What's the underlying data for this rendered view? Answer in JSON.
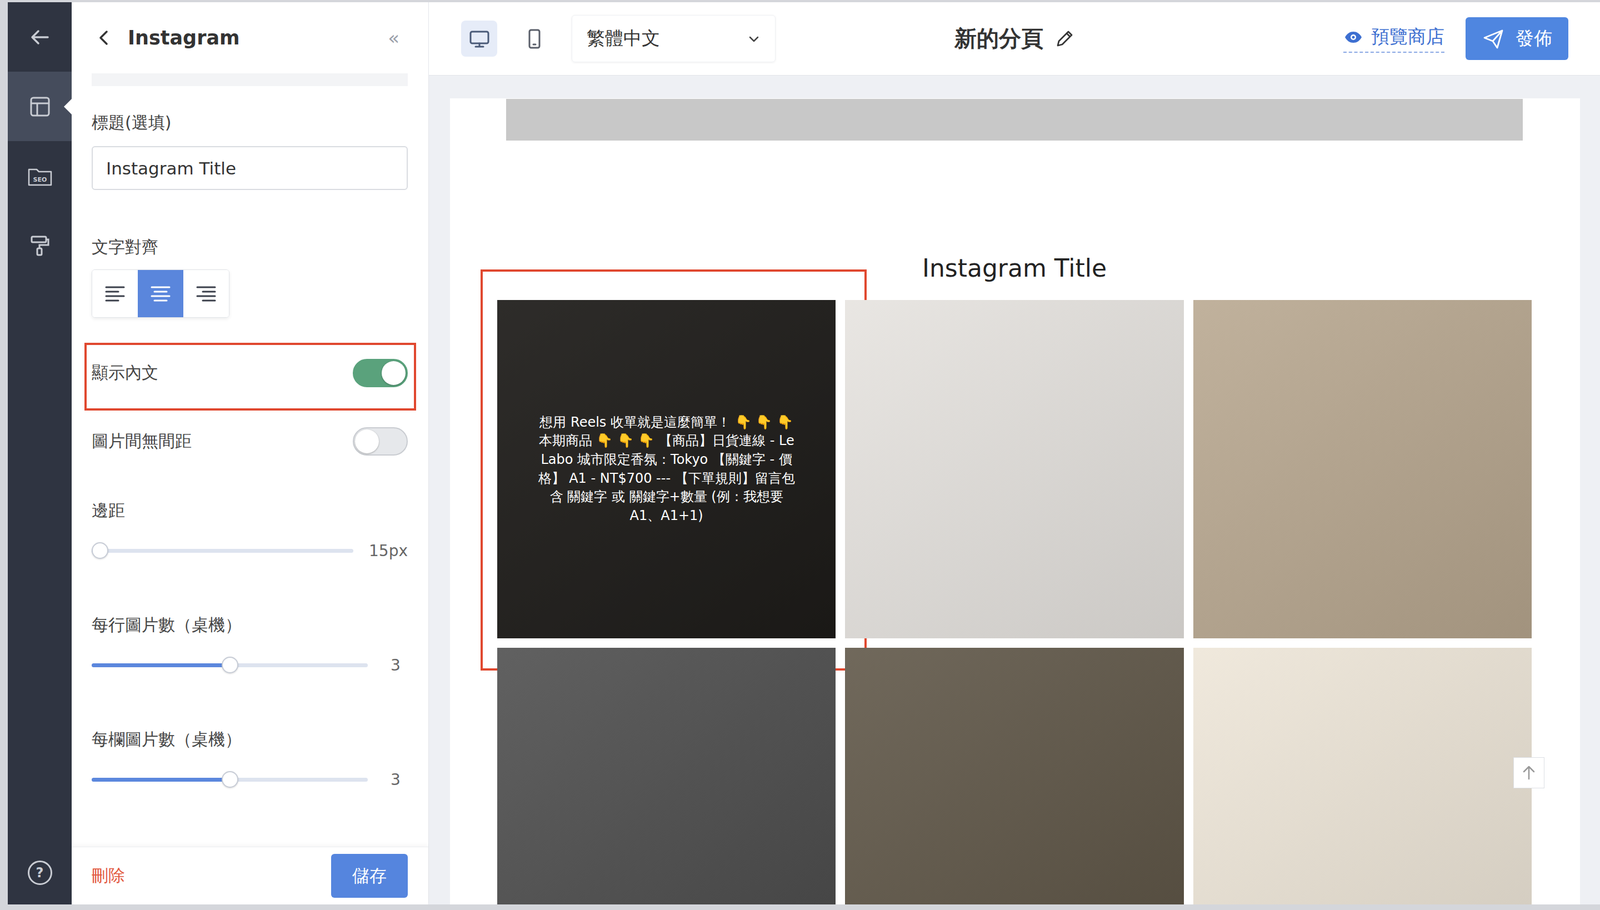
{
  "rail": {
    "items": [
      {
        "kind": "layout",
        "selected": true
      },
      {
        "kind": "seo",
        "label": "SEO",
        "selected": false
      },
      {
        "kind": "style",
        "selected": false
      }
    ],
    "help": "?"
  },
  "panel": {
    "title": "Instagram",
    "collapse": "«",
    "title_field": {
      "label": "標題(選填)",
      "value": "Instagram Title"
    },
    "alignment": {
      "label": "文字對齊",
      "options": [
        {
          "kind": "left",
          "selected": false
        },
        {
          "kind": "center",
          "selected": true
        },
        {
          "kind": "right",
          "selected": false
        }
      ]
    },
    "toggles": [
      {
        "label": "顯示內文",
        "on": true,
        "highlighted": true
      },
      {
        "label": "圖片間無間距",
        "on": false,
        "highlighted": false
      }
    ],
    "sliders": [
      {
        "label": "邊距",
        "level": 0.0,
        "reading": "15px"
      },
      {
        "label": "每行圖片數（桌機）",
        "level": 0.5,
        "reading": "3"
      },
      {
        "label": "每欄圖片數（桌機）",
        "level": 0.5,
        "reading": "3"
      }
    ],
    "delete": "刪除",
    "save": "儲存"
  },
  "toolbar": {
    "devices": [
      {
        "kind": "desktop",
        "selected": true
      },
      {
        "kind": "mobile",
        "selected": false
      }
    ],
    "language": "繁體中文",
    "page_title": "新的分頁",
    "preview": "預覽商店",
    "publish": "發佈"
  },
  "canvas": {
    "gallery_title": "Instagram Title",
    "posts": [
      {
        "caption": "想用 Reels 收單就是這麼簡單！ 👇 👇 👇本期商品 👇 👇 👇 【商品】日貨連線 - Le Labo 城市限定香氛：Tokyo 【關鍵字 - 價格】 A1 - NT$700 --- 【下單規則】留言包含 關鍵字 或 關鍵字+數量 (例：我想要 A1、A1+1)",
        "color": "#2e2b27",
        "highlighted": true
      },
      {
        "caption": "",
        "color": "#e6e3df",
        "highlighted": false
      },
      {
        "caption": "",
        "color": "#b8a78f",
        "highlighted": false
      },
      {
        "caption": "",
        "color": "#4b4b4b",
        "highlighted": false
      },
      {
        "caption": "",
        "color": "#5d5445",
        "highlighted": false
      },
      {
        "caption": "",
        "color": "#eee6d8",
        "highlighted": false
      }
    ]
  }
}
